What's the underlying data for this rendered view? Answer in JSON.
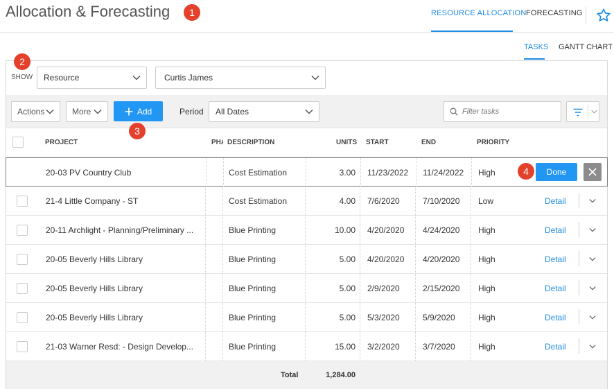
{
  "page": {
    "title": "Allocation & Forecasting"
  },
  "markers": [
    "1",
    "2",
    "3",
    "4"
  ],
  "top_tabs": [
    {
      "label": "RESOURCE ALLOCATION",
      "active": true
    },
    {
      "label": "FORECASTING",
      "active": false
    }
  ],
  "sub_tabs": [
    {
      "label": "TASKS",
      "active": true
    },
    {
      "label": "GANTT CHART",
      "active": false
    }
  ],
  "show": {
    "label": "SHOW",
    "type_value": "Resource",
    "resource_value": "Curtis James"
  },
  "toolbar": {
    "actions_label": "Actions",
    "more_label": "More",
    "add_label": "Add",
    "period_label": "Period",
    "period_value": "All Dates",
    "filter_placeholder": "Filter tasks"
  },
  "table": {
    "headers": {
      "project": "PROJECT",
      "phase": "PHASE",
      "description": "DESCRIPTION",
      "units": "UNITS",
      "start": "START",
      "end": "END",
      "priority": "PRIORITY"
    },
    "rows": [
      {
        "project": "20-03 PV Country Club",
        "description": "Cost Estimation",
        "units": "3.00",
        "start": "11/23/2022",
        "end": "11/24/2022",
        "priority": "High",
        "action": "Done"
      },
      {
        "project": "21-4 Little Company - ST",
        "description": "Cost Estimation",
        "units": "4.00",
        "start": "7/6/2020",
        "end": "7/10/2020",
        "priority": "Low",
        "action": "Detail"
      },
      {
        "project": "20-11 Archlight - Planning/Preliminary ...",
        "description": "Blue Printing",
        "units": "10.00",
        "start": "4/20/2020",
        "end": "4/24/2020",
        "priority": "High",
        "action": "Detail"
      },
      {
        "project": "20-05 Beverly Hills Library",
        "description": "Blue Printing",
        "units": "5.00",
        "start": "4/20/2020",
        "end": "4/20/2020",
        "priority": "High",
        "action": "Detail"
      },
      {
        "project": "20-05 Beverly Hills Library",
        "description": "Blue Printing",
        "units": "5.00",
        "start": "2/9/2020",
        "end": "2/15/2020",
        "priority": "High",
        "action": "Detail"
      },
      {
        "project": "20-05 Beverly Hills Library",
        "description": "Blue Printing",
        "units": "5.00",
        "start": "5/3/2020",
        "end": "5/9/2020",
        "priority": "High",
        "action": "Detail"
      },
      {
        "project": "21-03 Warner Resd: - Design Develop...",
        "description": "Blue Printing",
        "units": "15.00",
        "start": "3/2/2020",
        "end": "3/7/2020",
        "priority": "High",
        "action": "Detail"
      }
    ],
    "total_label": "Total",
    "total_value": "1,284.00"
  },
  "colors": {
    "accent": "#2196f3",
    "marker": "#e4412c",
    "link": "#1f8ce6"
  },
  "icons": [
    "star-icon",
    "plus-icon",
    "search-icon",
    "filter-icon",
    "chevron-down-icon",
    "close-icon"
  ]
}
